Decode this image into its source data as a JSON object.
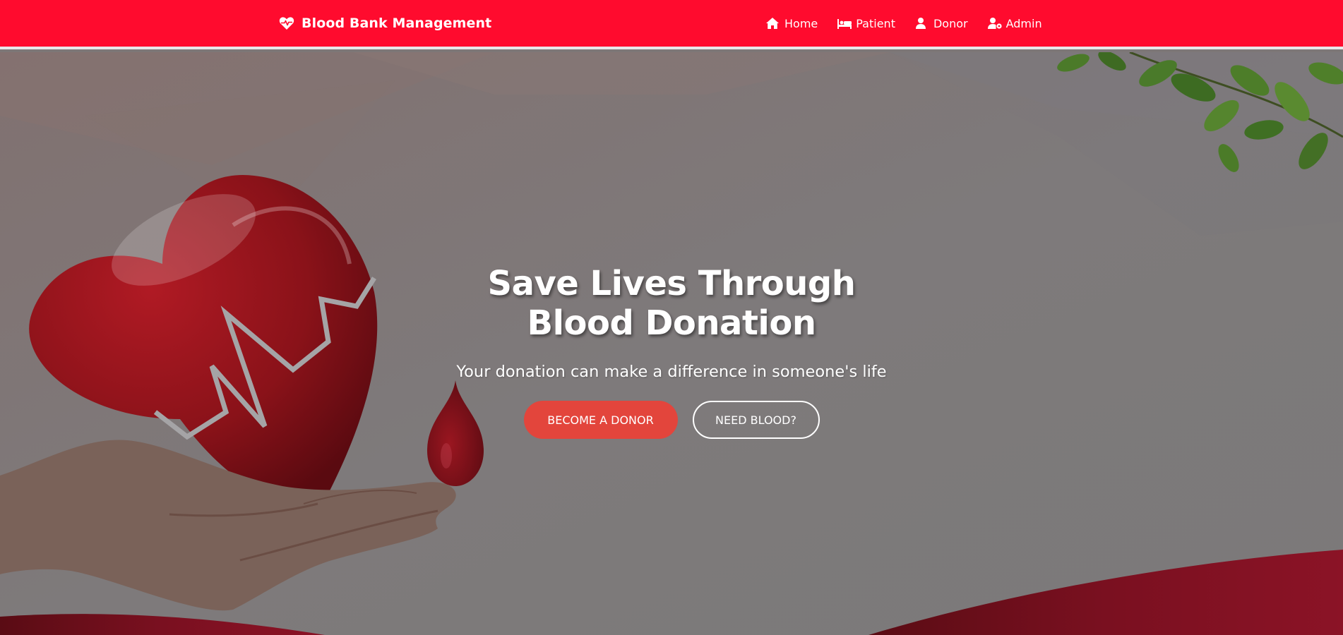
{
  "navbar": {
    "brand_label": "Blood Bank Management",
    "brand_icon": "heart-pulse-icon",
    "items": [
      {
        "label": "Home",
        "icon": "home-icon"
      },
      {
        "label": "Patient",
        "icon": "bed-icon"
      },
      {
        "label": "Donor",
        "icon": "user-icon"
      },
      {
        "label": "Admin",
        "icon": "user-cog-icon"
      }
    ]
  },
  "hero": {
    "title": "Save Lives Through Blood Donation",
    "subtitle": "Your donation can make a difference in someone's life",
    "primary_button": "BECOME A DONOR",
    "secondary_button": "NEED BLOOD?"
  },
  "colors": {
    "navbar": "#ff0b2e",
    "primary_button": "#e3453c",
    "overlay": "#7d7777"
  }
}
